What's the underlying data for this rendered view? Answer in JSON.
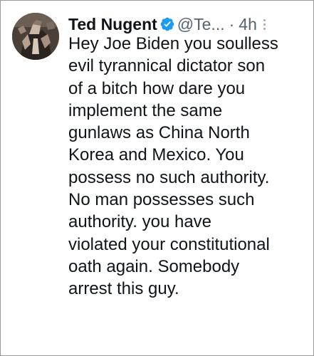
{
  "tweet": {
    "author_name": "Ted Nugent",
    "handle": "@Te...",
    "separator": "·",
    "timestamp": "4h",
    "verified_icon": "verified-badge-icon",
    "more_icon": "more-vertical-icon",
    "text_lines": [
      "Hey Joe Biden you soulless",
      "evil tyrannical dictator son",
      "of a bitch how dare you",
      "implement the same",
      "gunlaws as China North",
      "Korea and Mexico. You",
      "possess no such authority.",
      "No man possesses such",
      "authority. you have",
      "violated your constitutional",
      "oath again. Somebody",
      "arrest this guy."
    ]
  },
  "colors": {
    "verified": "#1d9bf0",
    "text": "#0f1419",
    "secondary": "#536471"
  }
}
